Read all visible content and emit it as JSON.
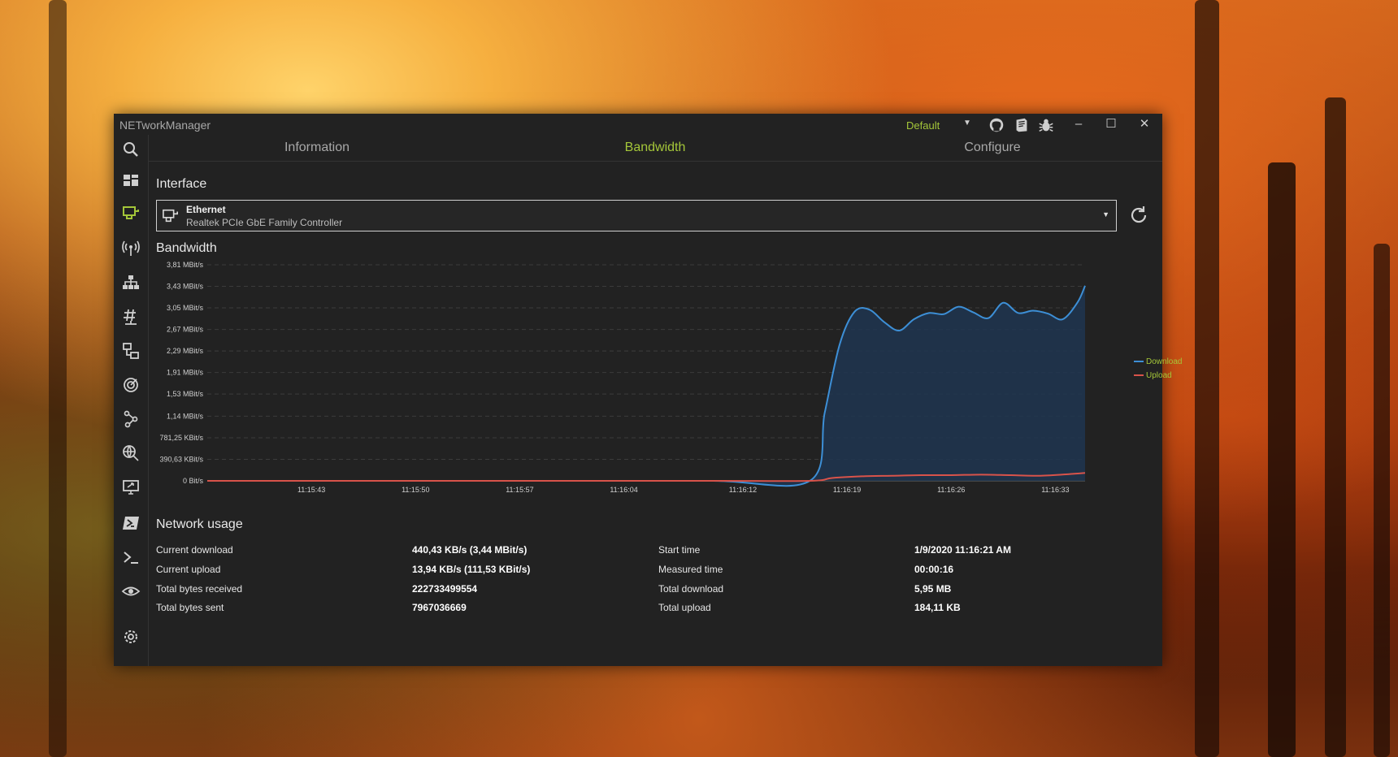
{
  "window": {
    "app_title": "NETworkManager",
    "profile": "Default"
  },
  "tabs": [
    {
      "label": "Information",
      "active": false
    },
    {
      "label": "Bandwidth",
      "active": true
    },
    {
      "label": "Configure",
      "active": false
    }
  ],
  "interface": {
    "section_title": "Interface",
    "name": "Ethernet",
    "description": "Realtek PCIe GbE Family Controller"
  },
  "bandwidth": {
    "section_title": "Bandwidth"
  },
  "chart_data": {
    "type": "area",
    "title": "Bandwidth",
    "xlabel": "",
    "ylabel": "",
    "y_tick_labels": [
      "0 Bit/s",
      "390,63 KBit/s",
      "781,25 KBit/s",
      "1,14 MBit/s",
      "1,53 MBit/s",
      "1,91 MBit/s",
      "2,29 MBit/s",
      "2,67 MBit/s",
      "3,05 MBit/s",
      "3,43 MBit/s",
      "3,81 MBit/s"
    ],
    "y_tick_values": [
      0,
      0.38,
      0.76,
      1.14,
      1.53,
      1.91,
      2.29,
      2.67,
      3.05,
      3.43,
      3.81
    ],
    "x_tick_labels": [
      "11:15:43",
      "11:15:50",
      "11:15:57",
      "11:16:04",
      "11:16:12",
      "11:16:19",
      "11:16:26",
      "11:16:33"
    ],
    "x_tick_seconds": [
      43,
      50,
      57,
      64,
      72,
      79,
      86,
      93
    ],
    "xlim_seconds": [
      36,
      95
    ],
    "ylim": [
      0,
      3.81
    ],
    "grid": true,
    "legend_position": "right",
    "series": [
      {
        "name": "Download",
        "color": "#3d8fd6",
        "fill": "#1f3550",
        "x_seconds": [
          36,
          40,
          50,
          60,
          70,
          76.5,
          77.5,
          78.5,
          79.5,
          80.5,
          81.5,
          82.5,
          83.5,
          84.5,
          85.5,
          86.5,
          87.5,
          88.5,
          89.5,
          90.5,
          91.5,
          92.5,
          93.5,
          94.5,
          95
        ],
        "values": [
          0,
          0,
          0,
          0,
          0,
          0,
          1.2,
          2.4,
          2.98,
          3.02,
          2.8,
          2.65,
          2.85,
          2.96,
          2.94,
          3.07,
          2.97,
          2.87,
          3.14,
          2.96,
          3.0,
          2.95,
          2.85,
          3.15,
          3.44
        ]
      },
      {
        "name": "Upload",
        "color": "#d8534a",
        "x_seconds": [
          36,
          50,
          60,
          70,
          76.5,
          78,
          80,
          82,
          84,
          86,
          88,
          90,
          92,
          94,
          95
        ],
        "values": [
          0,
          0,
          0,
          0,
          0,
          0.05,
          0.08,
          0.09,
          0.1,
          0.1,
          0.11,
          0.1,
          0.09,
          0.12,
          0.14
        ]
      }
    ]
  },
  "network_usage": {
    "section_title": "Network usage",
    "left": [
      {
        "label": "Current download",
        "value": "440,43 KB/s (3,44 MBit/s)"
      },
      {
        "label": "Current upload",
        "value": "13,94 KB/s (111,53 KBit/s)"
      },
      {
        "label": "Total bytes received",
        "value": "222733499554"
      },
      {
        "label": "Total bytes sent",
        "value": "7967036669"
      }
    ],
    "right": [
      {
        "label": "Start time",
        "value": "1/9/2020 11:16:21 AM"
      },
      {
        "label": "Measured time",
        "value": "00:00:16"
      },
      {
        "label": "Total download",
        "value": "5,95 MB"
      },
      {
        "label": "Total upload",
        "value": "184,11 KB"
      }
    ]
  },
  "colors": {
    "accent": "#a4c639",
    "window_bg": "#222222",
    "download": "#3d8fd6",
    "upload": "#d8534a"
  },
  "icons": {
    "sidebar": [
      "search-icon",
      "dashboard-icon",
      "network-interface-icon",
      "wifi-icon",
      "ip-scanner-icon",
      "port-icon",
      "ping-monitor-icon",
      "traceroute-icon",
      "dns-lookup-icon",
      "remote-desktop-icon",
      "powershell-icon",
      "terminal-icon",
      "eye-icon",
      "settings-icon"
    ]
  }
}
